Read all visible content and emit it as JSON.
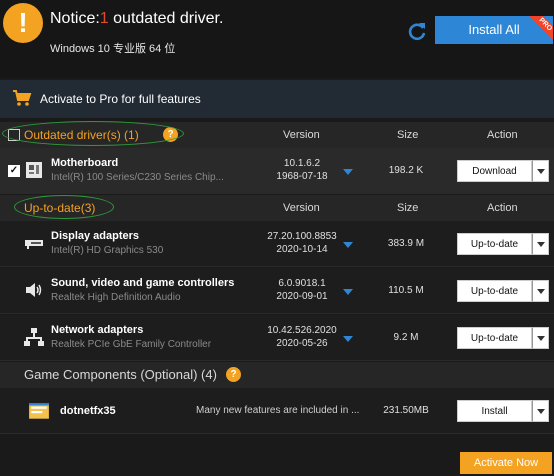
{
  "header": {
    "notice_prefix": "Notice:",
    "outdated_count": "1",
    "notice_suffix": " outdated driver.",
    "os_text": "Windows 10 专业版 64 位",
    "install_all_label": "Install All",
    "pro_badge": "PRO"
  },
  "promo": {
    "text": "Activate to Pro for full features"
  },
  "outdated_section": {
    "title": "Outdated driver(s) (1)",
    "help": "?",
    "col_version": "Version",
    "col_size": "Size",
    "col_action": "Action",
    "rows": [
      {
        "name": "Motherboard",
        "sub": "Intel(R) 100 Series/C230 Series Chip...",
        "version": "10.1.6.2",
        "date": "1968-07-18",
        "size": "198.2 K",
        "action": "Download",
        "checked": "✓"
      }
    ]
  },
  "uptodate_section": {
    "title": "Up-to-date(3)",
    "col_version": "Version",
    "col_size": "Size",
    "col_action": "Action",
    "rows": [
      {
        "name": "Display adapters",
        "sub": "Intel(R) HD Graphics 530",
        "version": "27.20.100.8853",
        "date": "2020-10-14",
        "size": "383.9 M",
        "action": "Up-to-date"
      },
      {
        "name": "Sound, video and game controllers",
        "sub": "Realtek High Definition Audio",
        "version": "6.0.9018.1",
        "date": "2020-09-01",
        "size": "110.5 M",
        "action": "Up-to-date"
      },
      {
        "name": "Network adapters",
        "sub": "Realtek PCIe GbE Family Controller",
        "version": "10.42.526.2020",
        "date": "2020-05-26",
        "size": "9.2 M",
        "action": "Up-to-date"
      }
    ]
  },
  "game_section": {
    "title": "Game Components (Optional) (4)",
    "help": "?",
    "rows": [
      {
        "name": "dotnetfx35",
        "desc": "Many new features are included in ...",
        "size": "231.50MB",
        "action": "Install"
      }
    ]
  },
  "footer": {
    "activate_now_label": "Activate Now"
  },
  "colors": {
    "accent_orange": "#f4a221",
    "accent_blue": "#2e86d6",
    "alert_red": "#e24a2b",
    "highlight_green": "#2e9a3c"
  }
}
